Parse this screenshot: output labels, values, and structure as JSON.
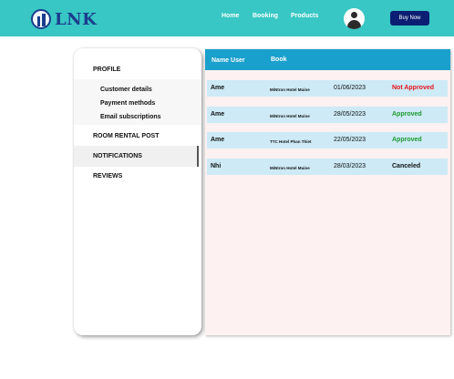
{
  "header": {
    "logo_text": "LNK",
    "nav": {
      "home": "Home",
      "booking": "Booking",
      "products": "Products"
    },
    "buy_now": "Buy Now",
    "colors": {
      "bar": "#38c7c4",
      "button": "#0b1e73",
      "logo": "#1b3d8c"
    }
  },
  "sidebar": {
    "profile": "PROFILE",
    "sub_items": [
      "Customer details",
      "Payment methods",
      "Email subscriptions"
    ],
    "room_rental": "ROOM RENTAL POST",
    "notifications": "NOTIFICATIONS",
    "reviews": "REVIEWS",
    "active": "NOTIFICATIONS"
  },
  "table": {
    "headers": {
      "name": "Name User",
      "book": "Book"
    },
    "rows": [
      {
        "name": "Ame",
        "hotel": "MiNtron Hotel Muine",
        "date": "01/06/2023",
        "status": "Not Approved",
        "status_color": "#e8141b"
      },
      {
        "name": "Ame",
        "hotel": "MiNtron Hotel Muine",
        "date": "28/05/2023",
        "status": "Approved",
        "status_color": "#1c9a2e"
      },
      {
        "name": "Ame",
        "hotel": "TTC Hotel Phan Thiet",
        "date": "22/05/2023",
        "status": "Approved",
        "status_color": "#1c9a2e"
      },
      {
        "name": "Nhi",
        "hotel": "MiNtron Hotel Muine",
        "date": "28/03/2023",
        "status": "Canceled",
        "status_color": "#111111"
      }
    ],
    "colors": {
      "header": "#1aa0cc",
      "row": "#cdeaf6",
      "panel": "#fdf1f1"
    }
  }
}
